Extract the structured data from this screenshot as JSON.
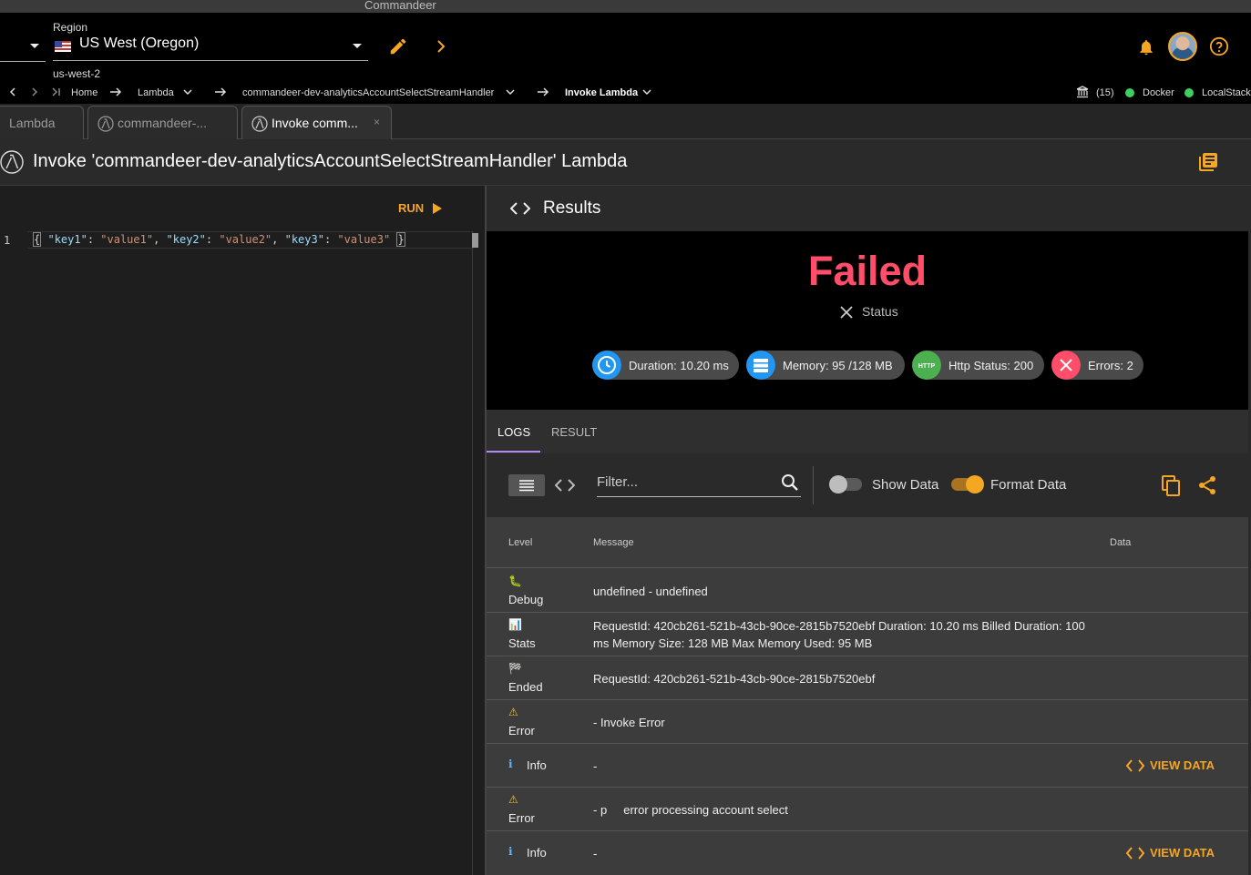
{
  "window": {
    "title": "Commandeer"
  },
  "header": {
    "region_label": "Region",
    "region_value": "US West (Oregon)",
    "region_code": "us-west-2"
  },
  "breadcrumbs": {
    "home": "Home",
    "lambda": "Lambda",
    "function": "commandeer-dev-analyticsAccountSelectStreamHandler",
    "page": "Invoke Lambda"
  },
  "status_bar": {
    "count": "(15)",
    "docker": "Docker",
    "localstack": "LocalStack"
  },
  "tabs": [
    {
      "label": "Lambda"
    },
    {
      "label": "commandeer-..."
    },
    {
      "label": "Invoke comm...",
      "close": "×"
    }
  ],
  "page": {
    "title": "Invoke 'commandeer-dev-analyticsAccountSelectStreamHandler' Lambda"
  },
  "editor": {
    "run_label": "RUN",
    "line_number": "1",
    "code": {
      "open": "{",
      "key1": "\"key1\"",
      "val1": "\"value1\"",
      "key2": "\"key2\"",
      "val2": "\"value2\"",
      "key3": "\"key3\"",
      "val3": "\"value3\"",
      "close": "}",
      "colon": ": ",
      "comma": ", "
    }
  },
  "results": {
    "title": "Results",
    "state": "Failed",
    "status_label": "Status",
    "chips": {
      "duration": "Duration: 10.20 ms",
      "memory": "Memory: 95 /128 MB",
      "http": "Http Status: 200",
      "http_icon_text": "HTTP",
      "errors": "Errors: 2"
    },
    "tabs": {
      "logs": "LOGS",
      "result": "RESULT"
    },
    "toolbar": {
      "filter_placeholder": "Filter...",
      "show_data": "Show Data",
      "format_data": "Format Data",
      "show_data_on": false,
      "format_data_on": true
    },
    "columns": {
      "level": "Level",
      "message": "Message",
      "data": "Data"
    },
    "view_data_label": "VIEW DATA",
    "logs": [
      {
        "icon": "🐛",
        "level": "Debug",
        "message": "undefined - undefined"
      },
      {
        "icon": "📊",
        "level": "Stats",
        "message": "RequestId: 420cb261-521b-43cb-90ce-2815b7520ebf Duration: 10.20 ms Billed Duration: 100 ms Memory Size: 128 MB Max Memory Used: 95 MB"
      },
      {
        "icon": "🏁",
        "level": "Ended",
        "message": "RequestId: 420cb261-521b-43cb-90ce-2815b7520ebf"
      },
      {
        "icon": "⚠",
        "level": "Error",
        "message": "- Invoke Error"
      },
      {
        "icon": "ℹ",
        "level": "Info",
        "message": "-"
      },
      {
        "icon": "⚠",
        "level": "Error",
        "message": "- p     error processing account select"
      },
      {
        "icon": "ℹ",
        "level": "Info",
        "message": "-"
      }
    ]
  },
  "colors": {
    "accent": "#f5a623",
    "failed": "#ff4d6a",
    "duration_icon": "#2196f3",
    "memory_icon": "#2196f3",
    "http_icon": "#4caf50",
    "errors_icon": "#ff4d6a",
    "online": "#3ecf5c"
  }
}
